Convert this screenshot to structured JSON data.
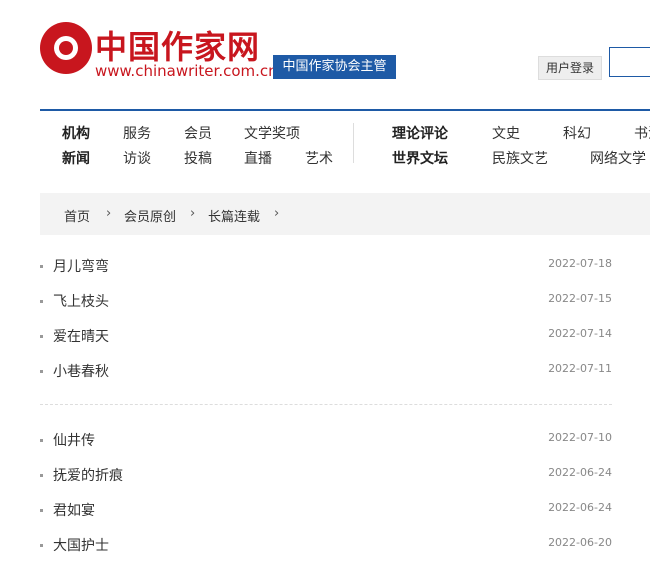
{
  "header": {
    "logo_title": "中国作家网",
    "logo_url": "www.chinawriter.com.cn",
    "org_badge": "中国作家协会主管",
    "login_label": "用户登录"
  },
  "nav": {
    "row1": [
      "机构",
      "服务",
      "会员",
      "文学奖项",
      "理论评论",
      "文史",
      "科幻",
      "书法"
    ],
    "row2": [
      "新闻",
      "访谈",
      "投稿",
      "直播",
      "艺术",
      "世界文坛",
      "民族文艺",
      "网络文学"
    ]
  },
  "breadcrumb": [
    "首页",
    "会员原创",
    "长篇连载"
  ],
  "articles_group1": [
    {
      "title": "月儿弯弯",
      "date": "2022-07-18"
    },
    {
      "title": "飞上枝头",
      "date": "2022-07-15"
    },
    {
      "title": "爱在晴天",
      "date": "2022-07-14"
    },
    {
      "title": "小巷春秋",
      "date": "2022-07-11"
    }
  ],
  "articles_group2": [
    {
      "title": "仙井传",
      "date": "2022-07-10"
    },
    {
      "title": "抚爱的折痕",
      "date": "2022-06-24"
    },
    {
      "title": "君如宴",
      "date": "2022-06-24"
    },
    {
      "title": "大国护士",
      "date": "2022-06-20"
    }
  ]
}
